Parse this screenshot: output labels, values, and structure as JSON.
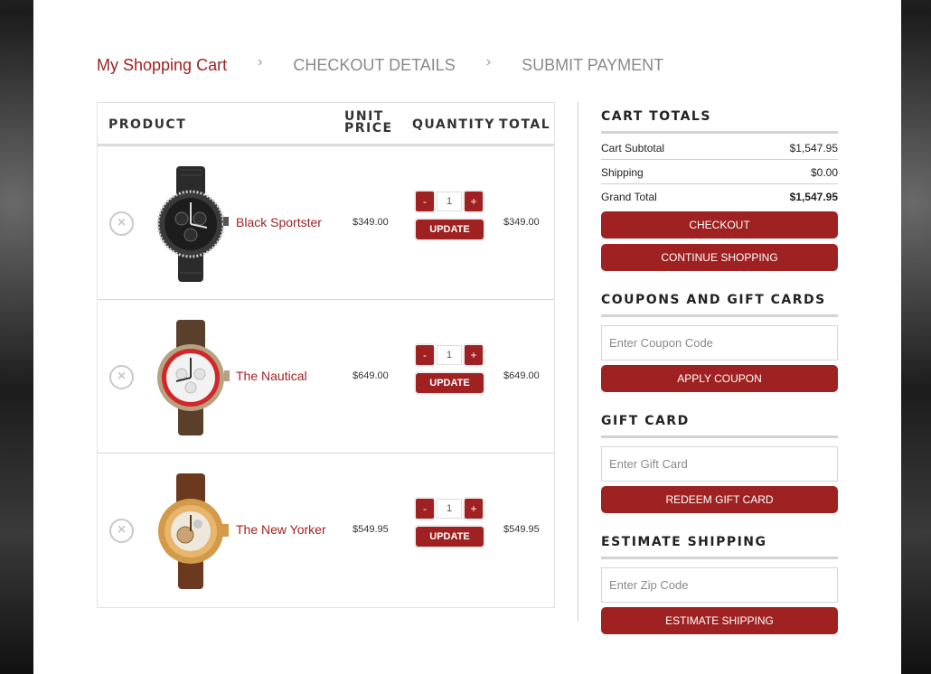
{
  "breadcrumb": {
    "step1": "My Shopping Cart",
    "step2": "CHECKOUT DETAILS",
    "step3": "SUBMIT PAYMENT",
    "separator": "›"
  },
  "cart": {
    "headers": {
      "product": "PRODUCT",
      "unit_price_line1": "UNIT",
      "unit_price_line2": "PRICE",
      "quantity": "QUANTITY",
      "total": "TOTAL"
    },
    "items": [
      {
        "name": "Black Sportster",
        "unit_price": "$349.00",
        "quantity": "1",
        "total": "$349.00",
        "update": "UPDATE",
        "minus": "-",
        "plus": "+",
        "remove": "×"
      },
      {
        "name": "The Nautical",
        "unit_price": "$649.00",
        "quantity": "1",
        "total": "$649.00",
        "update": "UPDATE",
        "minus": "-",
        "plus": "+",
        "remove": "×"
      },
      {
        "name": "The New Yorker",
        "unit_price": "$549.95",
        "quantity": "1",
        "total": "$549.95",
        "update": "UPDATE",
        "minus": "-",
        "plus": "+",
        "remove": "×"
      }
    ]
  },
  "totals": {
    "heading": "CART TOTALS",
    "subtotal_label": "Cart Subtotal",
    "subtotal_value": "$1,547.95",
    "shipping_label": "Shipping",
    "shipping_value": "$0.00",
    "grand_label": "Grand Total",
    "grand_value": "$1,547.95",
    "checkout_button": "CHECKOUT",
    "continue_button": "CONTINUE SHOPPING"
  },
  "coupons": {
    "heading": "COUPONS AND GIFT CARDS",
    "placeholder": "Enter Coupon Code",
    "button": "APPLY COUPON"
  },
  "giftcard": {
    "heading": "GIFT CARD",
    "placeholder": "Enter Gift Card",
    "button": "REDEEM GIFT CARD"
  },
  "shipping": {
    "heading": "ESTIMATE SHIPPING",
    "placeholder": "Enter Zip Code",
    "button": "ESTIMATE SHIPPING"
  },
  "colors": {
    "accent": "#9f2121"
  }
}
